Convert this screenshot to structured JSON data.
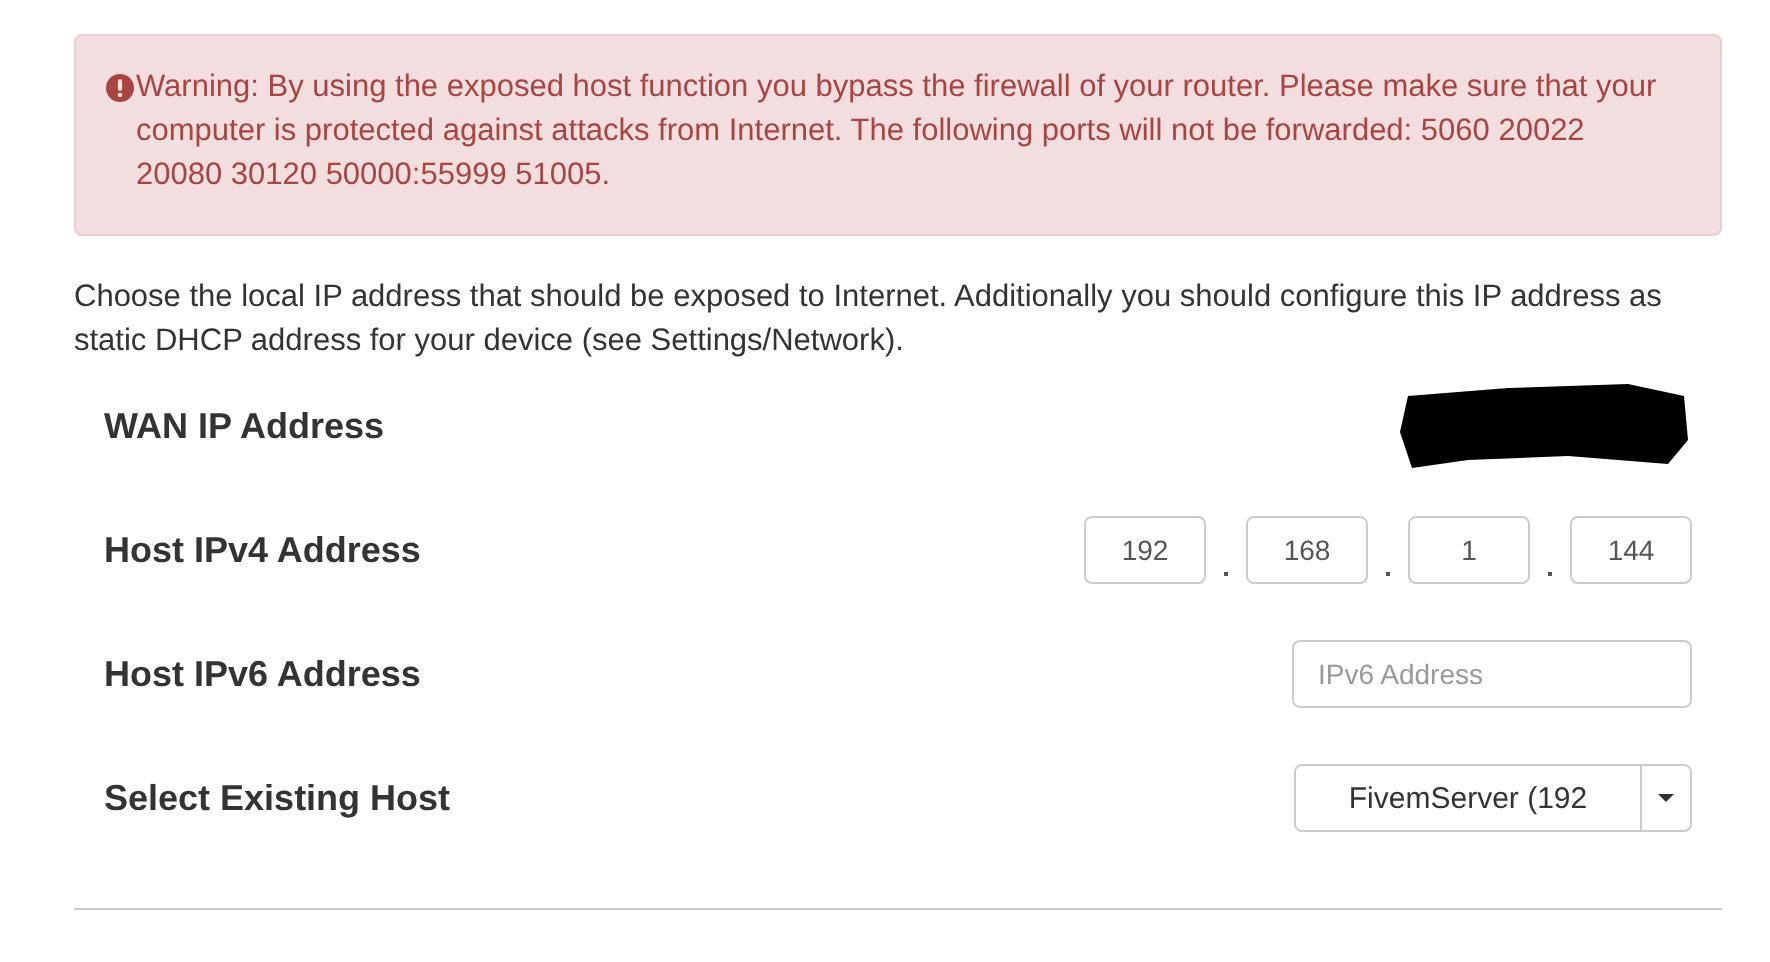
{
  "alert": {
    "text": "Warning: By using the exposed host function you bypass the firewall of your router. Please make sure that your computer is protected against attacks from Internet. The following ports will not be forwarded: 5060 20022 20080 30120 50000:55999 51005."
  },
  "description": "Choose the local IP address that should be exposed to Internet. Additionally you should configure this IP address as static DHCP address for your device (see Settings/Network).",
  "rows": [
    {
      "kind": "redacted",
      "label": "WAN IP Address"
    },
    {
      "kind": "ipv4",
      "label": "Host IPv4 Address",
      "octets": [
        "192",
        "168",
        "1",
        "144"
      ]
    },
    {
      "kind": "input",
      "label": "Host IPv6 Address",
      "placeholder": "IPv6 Address"
    },
    {
      "kind": "select",
      "label": "Select Existing Host",
      "value": "FivemServer (192"
    }
  ]
}
